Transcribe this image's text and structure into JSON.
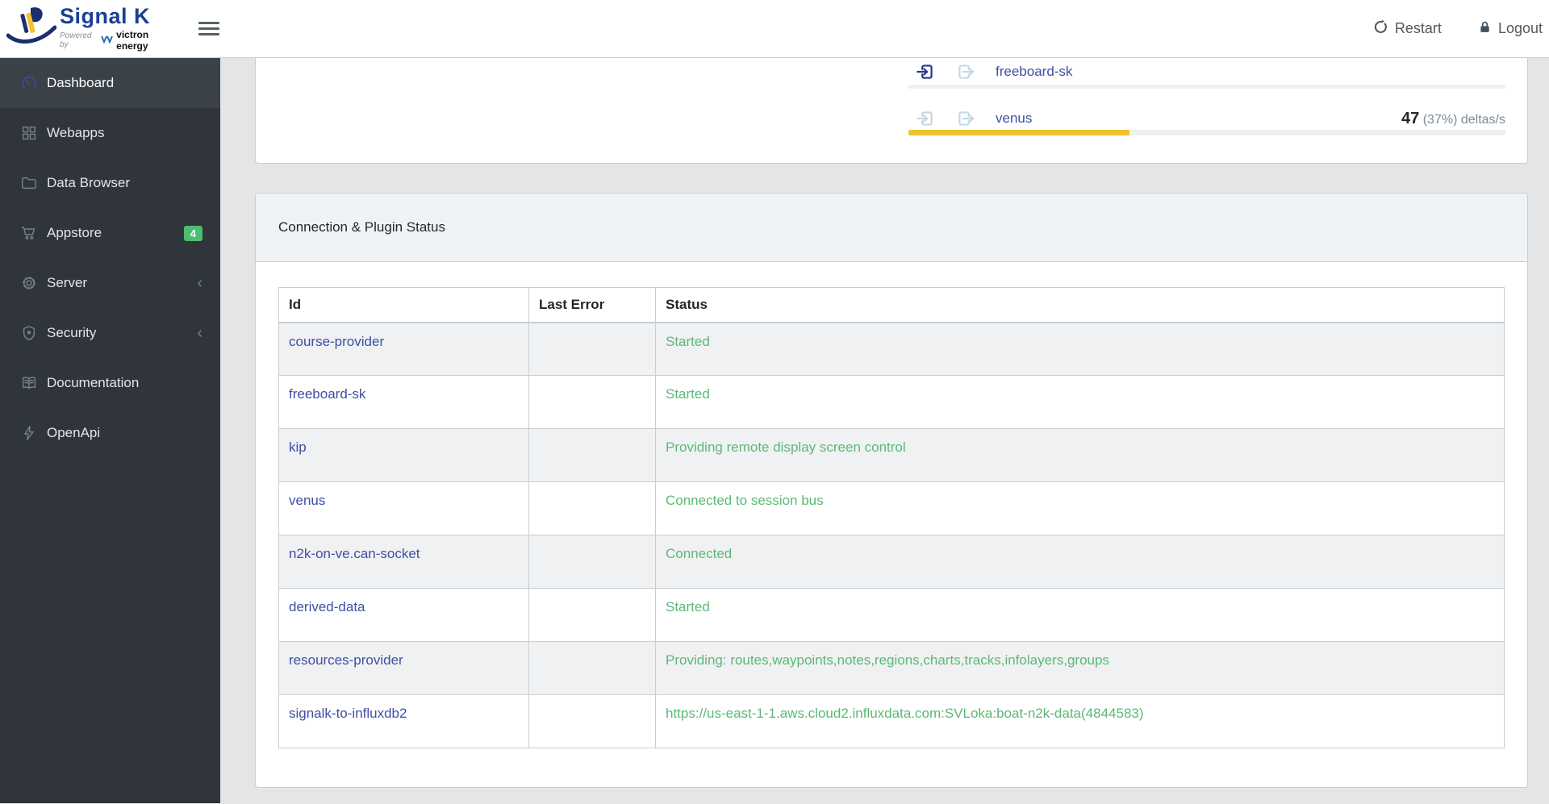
{
  "header": {
    "logo": {
      "title": "Signal K",
      "powered_by": "Powered by",
      "brand": "victron energy"
    },
    "restart_label": "Restart",
    "logout_label": "Logout"
  },
  "sidebar": {
    "items": [
      {
        "label": "Dashboard",
        "icon": "speedometer",
        "active": true
      },
      {
        "label": "Webapps",
        "icon": "grid"
      },
      {
        "label": "Data Browser",
        "icon": "folder"
      },
      {
        "label": "Appstore",
        "icon": "cart",
        "badge": "4"
      },
      {
        "label": "Server",
        "icon": "gear",
        "chevron": true
      },
      {
        "label": "Security",
        "icon": "shield",
        "chevron": true
      },
      {
        "label": "Documentation",
        "icon": "book"
      },
      {
        "label": "OpenApi",
        "icon": "bolt"
      }
    ]
  },
  "activity": {
    "rows": [
      {
        "name": "freeboard-sk",
        "input_active": true,
        "output_active": false,
        "progress": 0
      },
      {
        "name": "venus",
        "input_active": false,
        "output_active": false,
        "rate_value": "47",
        "rate_suffix": " (37%) deltas/s",
        "progress": 37
      }
    ]
  },
  "status_panel": {
    "title": "Connection & Plugin Status",
    "table": {
      "columns": [
        "Id",
        "Last Error",
        "Status"
      ],
      "rows": [
        {
          "id": "course-provider",
          "last_error": "",
          "status": "Started"
        },
        {
          "id": "freeboard-sk",
          "last_error": "",
          "status": "Started"
        },
        {
          "id": "kip",
          "last_error": "",
          "status": "Providing remote display screen control"
        },
        {
          "id": "venus",
          "last_error": "",
          "status": "Connected to session bus"
        },
        {
          "id": "n2k-on-ve.can-socket",
          "last_error": "",
          "status": "Connected"
        },
        {
          "id": "derived-data",
          "last_error": "",
          "status": "Started"
        },
        {
          "id": "resources-provider",
          "last_error": "",
          "status": "Providing: routes,waypoints,notes,regions,charts,tracks,infolayers,groups"
        },
        {
          "id": "signalk-to-influxdb2",
          "last_error": "",
          "status": "https://us-east-1-1.aws.cloud2.influxdata.com:SVLoka:boat-n2k-data(4844583)"
        }
      ]
    }
  },
  "colors": {
    "brand_blue": "#1b3f94",
    "input_active_navy": "#26368a",
    "link_blue": "#3e4fa5",
    "success_green": "#5cb878",
    "warning_yellow": "#efc32f",
    "badge_green": "#4dbd74",
    "sidebar_bg": "#2f353a",
    "sidebar_active_bg": "#3a4248",
    "card_header_bg": "#f0f3f5",
    "border_gray": "#c8ced3",
    "page_bg": "#e4e5e6"
  }
}
